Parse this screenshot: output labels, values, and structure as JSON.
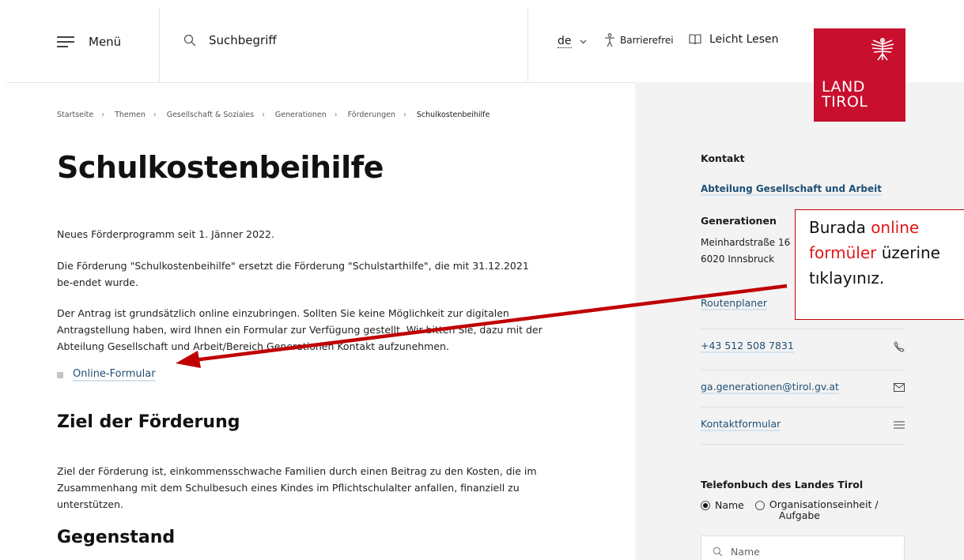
{
  "header": {
    "menu_label": "Menü",
    "search_placeholder": "Suchbegriff",
    "language": "de",
    "barrierefrei_label": "Barrierefrei",
    "leicht_lesen_label": "Leicht Lesen"
  },
  "logo": {
    "line1": "LAND",
    "line2": "TIROL"
  },
  "breadcrumb": [
    "Startseite",
    "Themen",
    "Gesellschaft & Soziales",
    "Generationen",
    "Förderungen",
    "Schulkostenbeihilfe"
  ],
  "main": {
    "title": "Schulkostenbeihilfe",
    "p1": "Neues Förderprogramm seit 1. Jänner 2022.",
    "p2": "Die Förderung \"Schulkostenbeihilfe\" ersetzt die Förderung \"Schulstarthilfe\", die mit 31.12.2021 be-endet wurde.",
    "p3": "Der Antrag ist grundsätzlich online einzubringen. Sollten Sie keine Möglichkeit zur digitalen Antragstellung haben, wird Ihnen ein Formular zur Verfügung gestellt. Wir bitten Sie, dazu mit der Abteilung Gesellschaft und Arbeit/Bereich Generationen Kontakt aufzunehmen.",
    "online_link": "Online-Formular",
    "h_ziel": "Ziel der Förderung",
    "p_ziel": "Ziel der Förderung ist, einkommensschwache Familien durch einen Beitrag zu den Kosten, die im Zusammenhang mit dem Schulbesuch eines Kindes im Pflichtschulalter anfallen, finanziell zu unterstützen.",
    "h_gegenstand": "Gegenstand"
  },
  "sidebar": {
    "kontakt": "Kontakt",
    "abteilung": "Abteilung Gesellschaft und Arbeit",
    "bereich": "Generationen",
    "street": "Meinhardstraße 16",
    "city": "6020 Innsbruck",
    "routenplaner": "Routenplaner",
    "phone": "+43 512 508 7831",
    "email": "ga.generationen@tirol.gv.at",
    "kontaktformular": "Kontaktformular",
    "telefonbuch": "Telefonbuch des Landes Tirol",
    "radio_name": "Name",
    "radio_org_line1": "Organisationseinheit /",
    "radio_org_line2": "Aufgabe",
    "name_placeholder": "Name"
  },
  "annotation": {
    "word1": "Burada ",
    "red1": "online",
    "red2": "formüler",
    "word2": " üzerine",
    "line3": "tıklayınız."
  },
  "colors": {
    "brand_red": "#c8102e",
    "link_blue": "#1f4f75",
    "panel_bg": "#f3f3f3",
    "annotation_red": "#c00000"
  }
}
